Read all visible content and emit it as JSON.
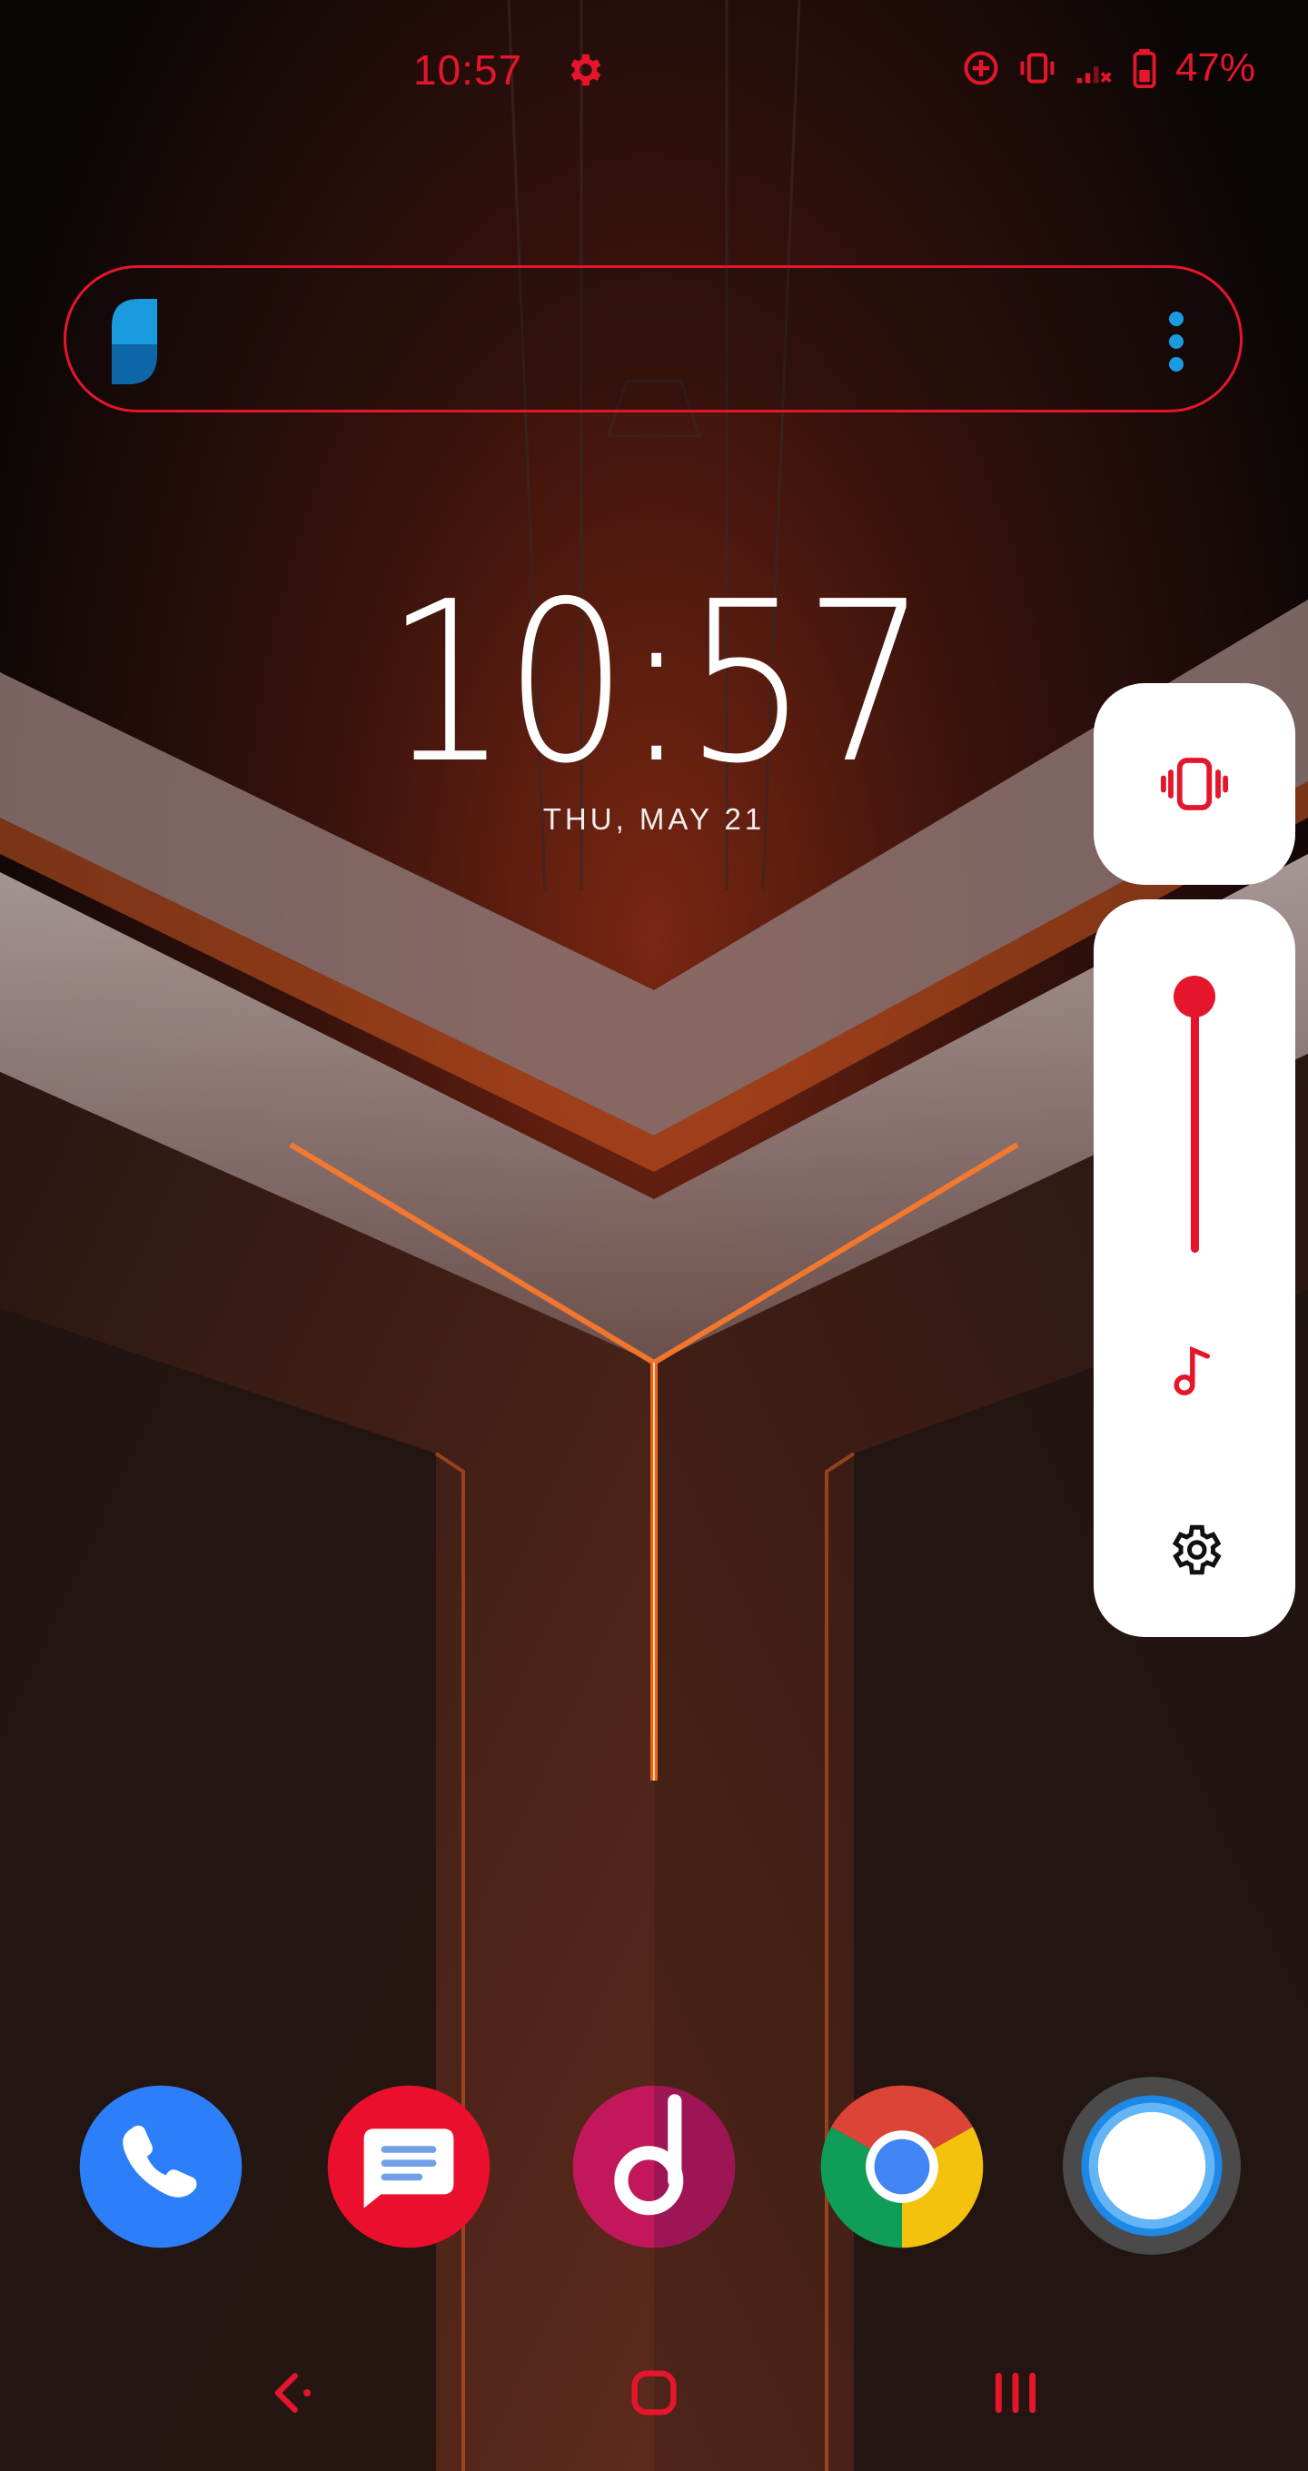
{
  "status_bar": {
    "time": "10:57",
    "battery": "47%",
    "icons": [
      "settings-icon",
      "data-saver-icon",
      "vibrate-icon",
      "signal-icon",
      "battery-icon"
    ]
  },
  "search_widget": {
    "logo": "search-app-logo",
    "menu_icon": "more-vert-icon"
  },
  "clock_widget": {
    "time": "10:57",
    "date": "THU, MAY 21"
  },
  "volume_panel": {
    "mode_icon": "vibrate-icon",
    "level": 1.0,
    "stream_icon": "music-note-icon",
    "settings_icon": "gear-icon"
  },
  "dock": {
    "apps": [
      "phone-app-icon",
      "messages-app-icon",
      "music-app-icon",
      "chrome-app-icon",
      "camera-app-icon"
    ]
  },
  "nav_bar": {
    "buttons": [
      "back-icon",
      "home-icon",
      "recents-icon"
    ]
  },
  "colors": {
    "accent": "#e5162c",
    "panel_bg": "#ffffff"
  }
}
